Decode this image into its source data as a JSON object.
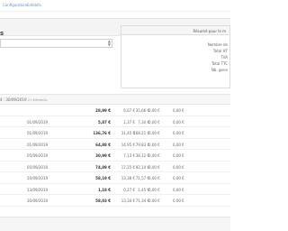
{
  "topnav": {
    "link1": "Configuration",
    "link2": "Exhibits"
  },
  "page_title": "s",
  "search": {
    "scroll_up": "▲",
    "scroll_down": "▼"
  },
  "summary": {
    "heading": "Résumé pour le m",
    "rows": [
      "Nombre de",
      "Total HT",
      "TVA",
      "Total TTC",
      "Nb. gene"
    ]
  },
  "period": {
    "label": "4 : 30/09/2019",
    "count": "21 éléments"
  },
  "rows": [
    {
      "date": "",
      "ttc": "28,99 €",
      "tva": "6,67 €",
      "ht": "35,66 €",
      "a": "0,00 €",
      "b": "0,00 €"
    },
    {
      "date": "01/09/2019",
      "ttc": "5,87 €",
      "tva": "1,37 €",
      "ht": "7,34 €",
      "a": "0,00 €",
      "b": "0,00 €"
    },
    {
      "date": "01/09/2019",
      "ttc": "136,76 €",
      "tva": "31,45 €",
      "ht": "168,21 €",
      "a": "0,00 €",
      "b": "0,00 €"
    },
    {
      "date": "01/09/2019",
      "ttc": "64,88 €",
      "tva": "14,95 €",
      "ht": "79,83 €",
      "a": "0,00 €",
      "b": "0,00 €"
    },
    {
      "date": "05/09/2019",
      "ttc": "30,99 €",
      "tva": "7,13 €",
      "ht": "38,12 €",
      "a": "0,00 €",
      "b": "0,00 €"
    },
    {
      "date": "05/09/2019",
      "ttc": "74,89 €",
      "tva": "17,25 €",
      "ht": "92,14 €",
      "a": "0,00 €",
      "b": "0,00 €"
    },
    {
      "date": "10/09/2019",
      "ttc": "58,19 €",
      "tva": "13,38 €",
      "ht": "71,57 €",
      "a": "0,00 €",
      "b": "0,00 €"
    },
    {
      "date": "13/09/2019",
      "ttc": "1,18 €",
      "tva": "0,27 €",
      "ht": "1,45 €",
      "a": "0,00 €",
      "b": "0,00 €"
    },
    {
      "date": "30/09/2019",
      "ttc": "58,03 €",
      "tva": "13,34 €",
      "ht": "71,34 €",
      "a": "0,00 €",
      "b": "0,00 €"
    }
  ]
}
